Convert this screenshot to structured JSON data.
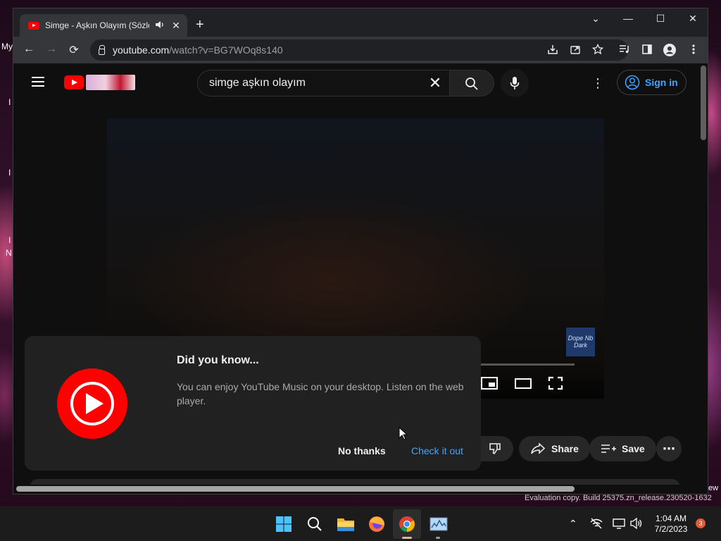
{
  "desktop": {
    "labels": [
      "My",
      "I",
      "I",
      "I",
      "N"
    ],
    "right_label": "ew"
  },
  "browser": {
    "tab": {
      "title": "Simge - Aşkın Olayım (Sözler",
      "audio_icon": "speaker-icon",
      "close_glyph": "✕"
    },
    "new_tab_glyph": "+",
    "window_controls": [
      "⌄",
      "—",
      "☐",
      "✕"
    ],
    "nav": {
      "back": "←",
      "forward": "→",
      "reload": "⟳"
    },
    "url_host": "youtube.com",
    "url_path": "/watch?v=BG7WOq8s140",
    "toolbar_icons": [
      "install-icon",
      "share-icon",
      "star-icon",
      "media-control-icon",
      "sidebar-icon",
      "profile-icon",
      "menu-icon"
    ]
  },
  "youtube": {
    "search": {
      "value": "simge aşkın olayım",
      "clear_glyph": "✕"
    },
    "kebab_glyph": "⋮",
    "sign_in_label": "Sign in",
    "channel_watermark_text": "Dope Nb Dark",
    "actions": {
      "share_label": "Share",
      "save_label": "Save",
      "more_glyph": "⋯"
    },
    "dialog": {
      "title": "Did you know...",
      "body": "You can enjoy YouTube Music on your desktop. Listen on the web player.",
      "no_thanks_label": "No thanks",
      "check_it_out_label": "Check it out"
    }
  },
  "os": {
    "watermark": "Evaluation copy. Build 25375.zn_release.230520-1632",
    "clock_time": "1:04 AM",
    "clock_date": "7/2/2023",
    "notification_count": "3",
    "tray_icons": [
      "chevron-up-icon",
      "network-off-icon",
      "display-icon",
      "volume-icon"
    ],
    "tray_chevron": "⌃"
  },
  "colors": {
    "youtube_red": "#ff0000",
    "link_blue": "#3ea6ff",
    "page_bg": "#0f0f0f",
    "dialog_bg": "#212121"
  }
}
